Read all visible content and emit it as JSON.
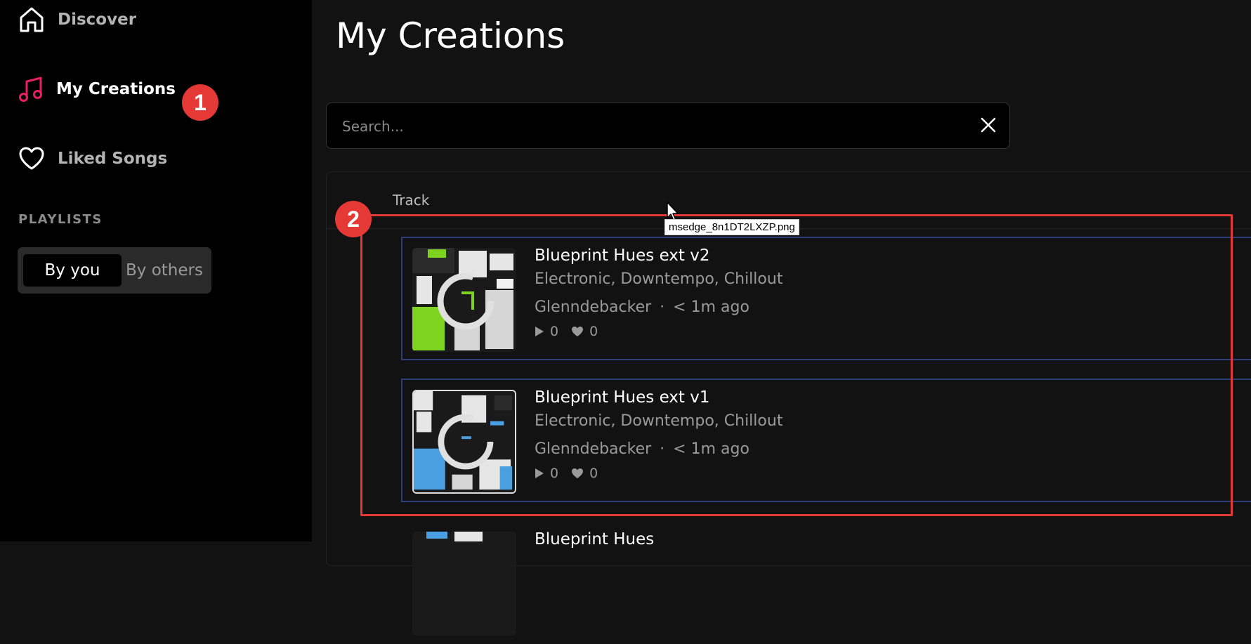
{
  "sidebar": {
    "nav": [
      {
        "label": "Discover",
        "icon": "home-icon",
        "active": false
      },
      {
        "label": "My Creations",
        "icon": "music-note-icon",
        "active": true
      },
      {
        "label": "Liked Songs",
        "icon": "heart-icon",
        "active": false
      }
    ],
    "playlists_heading": "PLAYLISTS",
    "segmented": {
      "options": [
        "By you",
        "By others"
      ],
      "selected": "By you"
    }
  },
  "main": {
    "title": "My Creations",
    "search": {
      "placeholder": "Search...",
      "value": ""
    },
    "table": {
      "column_header": "Track",
      "rows": [
        {
          "title": "Blueprint Hues ext v2",
          "genres": "Electronic, Downtempo, Chillout",
          "author": "Glenndebacker",
          "separator": "·",
          "time": "< 1m ago",
          "plays": "0",
          "likes": "0",
          "accent": "#7ed321"
        },
        {
          "title": "Blueprint Hues ext v1",
          "genres": "Electronic, Downtempo, Chillout",
          "author": "Glenndebacker",
          "separator": "·",
          "time": "< 1m ago",
          "plays": "0",
          "likes": "0",
          "accent": "#4a9fe0"
        },
        {
          "title": "Blueprint Hues"
        }
      ]
    }
  },
  "annotations": {
    "badge_1": "1",
    "badge_2": "2"
  },
  "tooltip": "msedge_8n1DT2LXZP.png",
  "colors": {
    "accent_pink": "#e91e63",
    "annotation_red": "#e53935",
    "row_border": "#2b3f7a"
  }
}
